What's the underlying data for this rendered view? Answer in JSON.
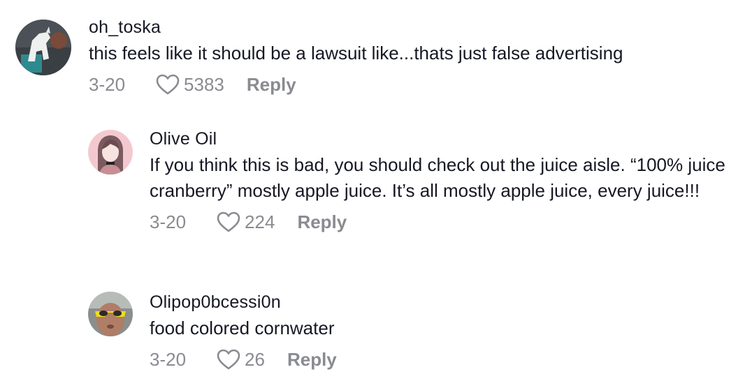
{
  "comments": [
    {
      "username": "oh_toska",
      "text": "this feels like it should be a lawsuit like...thats just false advertising",
      "date": "3-20",
      "likes": "5383",
      "reply_label": "Reply"
    },
    {
      "username": "Olive Oil",
      "text": "If you think this is bad, you should check out the juice aisle. “100% juice cranberry” mostly apple juice. It’s all mostly apple juice, every juice!!!",
      "date": "3-20",
      "likes": "224",
      "reply_label": "Reply"
    },
    {
      "username": "Olipop0bcessi0n",
      "text": "food colored cornwater",
      "date": "3-20",
      "likes": "26",
      "reply_label": "Reply"
    }
  ],
  "icons": {
    "like": "heart-outline-icon"
  },
  "colors": {
    "text": "#161823",
    "meta": "#8a8b91",
    "background": "#ffffff"
  }
}
